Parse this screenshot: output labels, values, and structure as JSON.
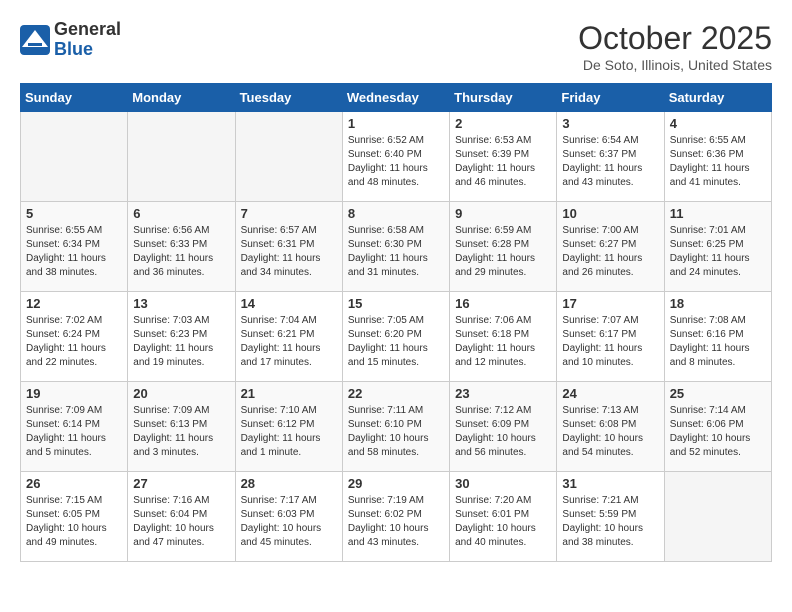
{
  "header": {
    "logo_general": "General",
    "logo_blue": "Blue",
    "month": "October 2025",
    "location": "De Soto, Illinois, United States"
  },
  "days_of_week": [
    "Sunday",
    "Monday",
    "Tuesday",
    "Wednesday",
    "Thursday",
    "Friday",
    "Saturday"
  ],
  "weeks": [
    [
      {
        "day": "",
        "info": ""
      },
      {
        "day": "",
        "info": ""
      },
      {
        "day": "",
        "info": ""
      },
      {
        "day": "1",
        "info": "Sunrise: 6:52 AM\nSunset: 6:40 PM\nDaylight: 11 hours\nand 48 minutes."
      },
      {
        "day": "2",
        "info": "Sunrise: 6:53 AM\nSunset: 6:39 PM\nDaylight: 11 hours\nand 46 minutes."
      },
      {
        "day": "3",
        "info": "Sunrise: 6:54 AM\nSunset: 6:37 PM\nDaylight: 11 hours\nand 43 minutes."
      },
      {
        "day": "4",
        "info": "Sunrise: 6:55 AM\nSunset: 6:36 PM\nDaylight: 11 hours\nand 41 minutes."
      }
    ],
    [
      {
        "day": "5",
        "info": "Sunrise: 6:55 AM\nSunset: 6:34 PM\nDaylight: 11 hours\nand 38 minutes."
      },
      {
        "day": "6",
        "info": "Sunrise: 6:56 AM\nSunset: 6:33 PM\nDaylight: 11 hours\nand 36 minutes."
      },
      {
        "day": "7",
        "info": "Sunrise: 6:57 AM\nSunset: 6:31 PM\nDaylight: 11 hours\nand 34 minutes."
      },
      {
        "day": "8",
        "info": "Sunrise: 6:58 AM\nSunset: 6:30 PM\nDaylight: 11 hours\nand 31 minutes."
      },
      {
        "day": "9",
        "info": "Sunrise: 6:59 AM\nSunset: 6:28 PM\nDaylight: 11 hours\nand 29 minutes."
      },
      {
        "day": "10",
        "info": "Sunrise: 7:00 AM\nSunset: 6:27 PM\nDaylight: 11 hours\nand 26 minutes."
      },
      {
        "day": "11",
        "info": "Sunrise: 7:01 AM\nSunset: 6:25 PM\nDaylight: 11 hours\nand 24 minutes."
      }
    ],
    [
      {
        "day": "12",
        "info": "Sunrise: 7:02 AM\nSunset: 6:24 PM\nDaylight: 11 hours\nand 22 minutes."
      },
      {
        "day": "13",
        "info": "Sunrise: 7:03 AM\nSunset: 6:23 PM\nDaylight: 11 hours\nand 19 minutes."
      },
      {
        "day": "14",
        "info": "Sunrise: 7:04 AM\nSunset: 6:21 PM\nDaylight: 11 hours\nand 17 minutes."
      },
      {
        "day": "15",
        "info": "Sunrise: 7:05 AM\nSunset: 6:20 PM\nDaylight: 11 hours\nand 15 minutes."
      },
      {
        "day": "16",
        "info": "Sunrise: 7:06 AM\nSunset: 6:18 PM\nDaylight: 11 hours\nand 12 minutes."
      },
      {
        "day": "17",
        "info": "Sunrise: 7:07 AM\nSunset: 6:17 PM\nDaylight: 11 hours\nand 10 minutes."
      },
      {
        "day": "18",
        "info": "Sunrise: 7:08 AM\nSunset: 6:16 PM\nDaylight: 11 hours\nand 8 minutes."
      }
    ],
    [
      {
        "day": "19",
        "info": "Sunrise: 7:09 AM\nSunset: 6:14 PM\nDaylight: 11 hours\nand 5 minutes."
      },
      {
        "day": "20",
        "info": "Sunrise: 7:09 AM\nSunset: 6:13 PM\nDaylight: 11 hours\nand 3 minutes."
      },
      {
        "day": "21",
        "info": "Sunrise: 7:10 AM\nSunset: 6:12 PM\nDaylight: 11 hours\nand 1 minute."
      },
      {
        "day": "22",
        "info": "Sunrise: 7:11 AM\nSunset: 6:10 PM\nDaylight: 10 hours\nand 58 minutes."
      },
      {
        "day": "23",
        "info": "Sunrise: 7:12 AM\nSunset: 6:09 PM\nDaylight: 10 hours\nand 56 minutes."
      },
      {
        "day": "24",
        "info": "Sunrise: 7:13 AM\nSunset: 6:08 PM\nDaylight: 10 hours\nand 54 minutes."
      },
      {
        "day": "25",
        "info": "Sunrise: 7:14 AM\nSunset: 6:06 PM\nDaylight: 10 hours\nand 52 minutes."
      }
    ],
    [
      {
        "day": "26",
        "info": "Sunrise: 7:15 AM\nSunset: 6:05 PM\nDaylight: 10 hours\nand 49 minutes."
      },
      {
        "day": "27",
        "info": "Sunrise: 7:16 AM\nSunset: 6:04 PM\nDaylight: 10 hours\nand 47 minutes."
      },
      {
        "day": "28",
        "info": "Sunrise: 7:17 AM\nSunset: 6:03 PM\nDaylight: 10 hours\nand 45 minutes."
      },
      {
        "day": "29",
        "info": "Sunrise: 7:19 AM\nSunset: 6:02 PM\nDaylight: 10 hours\nand 43 minutes."
      },
      {
        "day": "30",
        "info": "Sunrise: 7:20 AM\nSunset: 6:01 PM\nDaylight: 10 hours\nand 40 minutes."
      },
      {
        "day": "31",
        "info": "Sunrise: 7:21 AM\nSunset: 5:59 PM\nDaylight: 10 hours\nand 38 minutes."
      },
      {
        "day": "",
        "info": ""
      }
    ]
  ]
}
